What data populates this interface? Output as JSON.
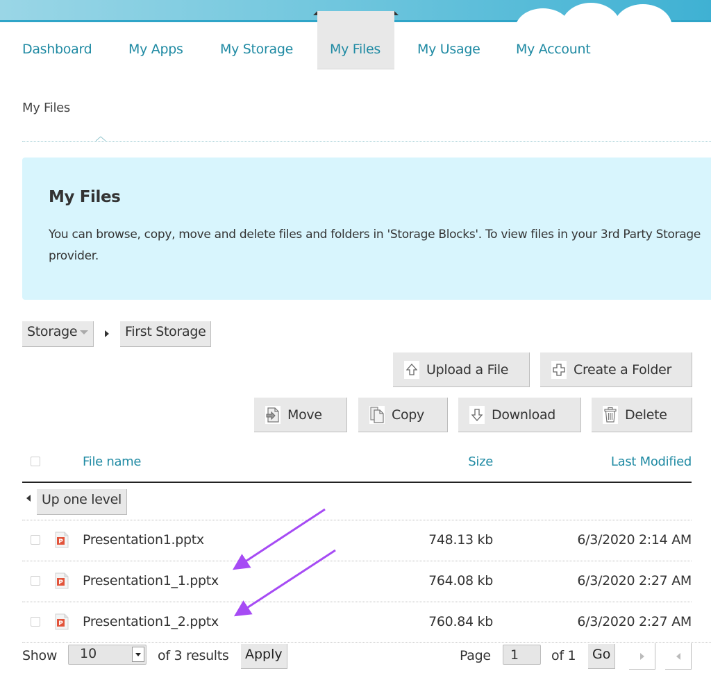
{
  "nav": {
    "items": [
      {
        "label": "Dashboard",
        "active": false
      },
      {
        "label": "My Apps",
        "active": false
      },
      {
        "label": "My Storage",
        "active": false
      },
      {
        "label": "My Files",
        "active": true
      },
      {
        "label": "My Usage",
        "active": false
      },
      {
        "label": "My Account",
        "active": false
      }
    ]
  },
  "page": {
    "heading": "My Files"
  },
  "info": {
    "title": "My Files",
    "text": "You can browse, copy, move and delete files and folders in 'Storage Blocks'. To view files in your 3rd Party Storage provider."
  },
  "breadcrumb": {
    "root": "Storage",
    "current": "First Storage"
  },
  "actions": {
    "upload": "Upload a File",
    "create_folder": "Create a Folder",
    "move": "Move",
    "copy": "Copy",
    "download": "Download",
    "delete": "Delete"
  },
  "table": {
    "columns": {
      "name": "File name",
      "size": "Size",
      "modified": "Last Modified"
    },
    "up_level": "Up one level",
    "rows": [
      {
        "name": "Presentation1.pptx",
        "size": "748.13 kb",
        "modified": "6/3/2020 2:14 AM",
        "icon": "pptx-file-icon"
      },
      {
        "name": "Presentation1_1.pptx",
        "size": "764.08 kb",
        "modified": "6/3/2020 2:27 AM",
        "icon": "pptx-file-icon"
      },
      {
        "name": "Presentation1_2.pptx",
        "size": "760.84 kb",
        "modified": "6/3/2020 2:27 AM",
        "icon": "pptx-file-icon"
      }
    ]
  },
  "footer": {
    "show_label": "Show",
    "page_size": "10",
    "results_text": "of 3 results",
    "apply": "Apply",
    "page_label": "Page",
    "page_value": "1",
    "page_of": "of 1",
    "go": "Go"
  },
  "colors": {
    "accent": "#1f8aa3",
    "info_bg": "#d8f5fd",
    "annotation_arrow": "#a64bf4"
  }
}
